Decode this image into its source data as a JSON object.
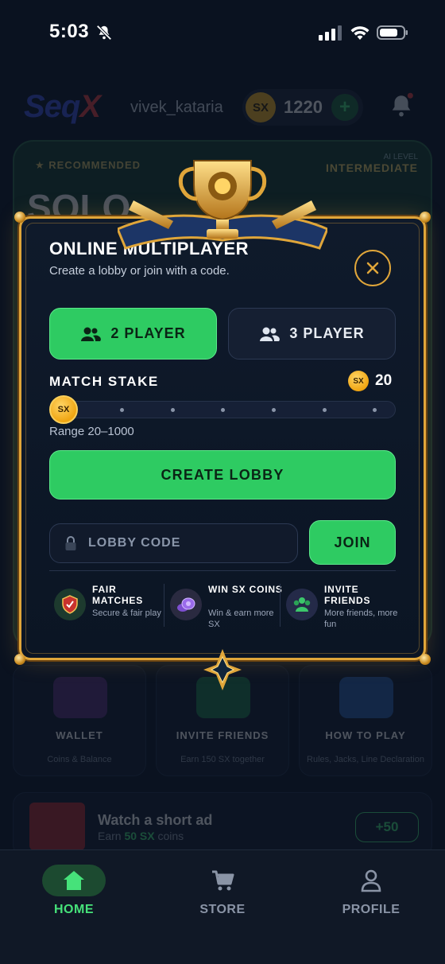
{
  "status_bar": {
    "time": "5:03"
  },
  "background_app": {
    "logo": {
      "part1": "Seq",
      "part2": "X"
    },
    "username": "vivek_kataria",
    "coins": {
      "symbol": "SX",
      "amount": "1220",
      "add": "+"
    },
    "hero": {
      "badge": "RECOMMENDED",
      "ai_level_label": "AI LEVEL",
      "ai_level_value": "INTERMEDIATE",
      "mode": "SOLO"
    },
    "tiles": [
      {
        "title": "WALLET",
        "sub": "Coins & Balance"
      },
      {
        "title": "INVITE FRIENDS",
        "sub": "Earn 150 SX together"
      },
      {
        "title": "HOW TO PLAY",
        "sub": "Rules, Jacks, Line Declaration"
      }
    ],
    "ad": {
      "title": "Watch a short ad",
      "sub_prefix": "Earn",
      "sub_amount": "50 SX",
      "sub_suffix": "coins",
      "reward": "+50"
    }
  },
  "modal": {
    "title": "ONLINE MULTIPLAYER",
    "subtitle": "Create a lobby or join with a code.",
    "player_options": [
      {
        "label": "2 PLAYER",
        "selected": true
      },
      {
        "label": "3 PLAYER",
        "selected": false
      }
    ],
    "stake": {
      "label": "MATCH STAKE",
      "currency": "SX",
      "value": "20",
      "thumb_label": "SX",
      "position_fraction": 0,
      "range_text": "Range 20–1000"
    },
    "create_lobby_label": "CREATE LOBBY",
    "lobby_code": {
      "placeholder": "LOBBY CODE",
      "value": ""
    },
    "join_label": "JOIN",
    "features": [
      {
        "title": "FAIR MATCHES",
        "sub": "Secure & fair play",
        "icon": "shield-icon"
      },
      {
        "title": "WIN SX COINS",
        "sub": "Win & earn more SX",
        "icon": "coins-icon"
      },
      {
        "title": "INVITE FRIENDS",
        "sub": "More friends, more fun",
        "icon": "friends-icon"
      }
    ]
  },
  "bottom_nav": [
    {
      "label": "HOME",
      "icon": "home-icon",
      "active": true
    },
    {
      "label": "STORE",
      "icon": "cart-icon",
      "active": false
    },
    {
      "label": "PROFILE",
      "icon": "profile-icon",
      "active": false
    }
  ],
  "colors": {
    "accent_green": "#2ecb62",
    "gold": "#e0a63a",
    "background": "#0a1220"
  }
}
